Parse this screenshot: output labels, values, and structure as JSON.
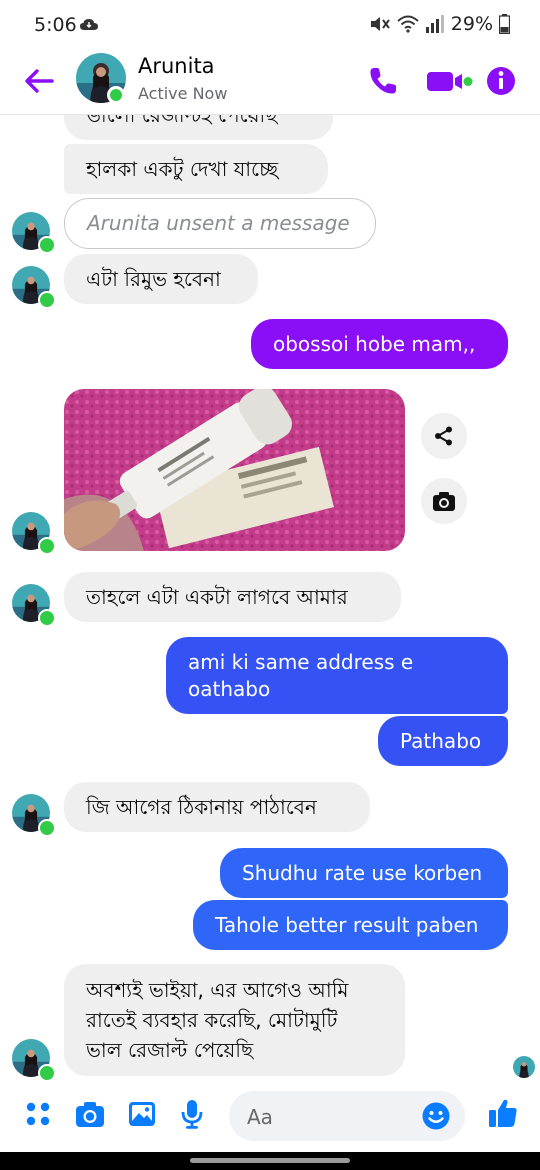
{
  "status_bar": {
    "time": "5:06",
    "battery": "29%"
  },
  "header": {
    "name": "Arunita",
    "status": "Active Now"
  },
  "messages": {
    "m0": "ভালো রেজাল্টই পেয়েছি",
    "m1": "হালকা একটু দেখা যাচ্ছে",
    "m2": "Arunita unsent a message",
    "m3": "এটা রিমুভ হবেনা",
    "m4": "obossoi hobe mam,,",
    "m5": "তাহলে এটা একটা লাগবে আমার",
    "m6_line1": "ami ki same address e",
    "m6_line2": "oathabo",
    "m7": "Pathabo",
    "m8": "জি আগের ঠিকানায় পাঠাবেন",
    "m9": "Shudhu rate use korben",
    "m10": "Tahole better result paben",
    "m11_line1": "অবশ্যই ভাইয়া, এর আগেও আমি",
    "m11_line2": "রাতেই ব্যবহার করেছি, মোটামুটি",
    "m11_line3": "ভাল রেজাল্ট পেয়েছি"
  },
  "composer": {
    "placeholder": "Aa"
  },
  "colors": {
    "accent": "#8b0ff6",
    "blue": "#3553f5",
    "active": "#31cc46",
    "incoming": "#efefef"
  },
  "icons": [
    "back-arrow-icon",
    "phone-icon",
    "video-icon",
    "info-icon",
    "share-icon",
    "camera-icon",
    "grid-icon",
    "image-icon",
    "mic-icon",
    "emoji-icon",
    "like-icon"
  ]
}
